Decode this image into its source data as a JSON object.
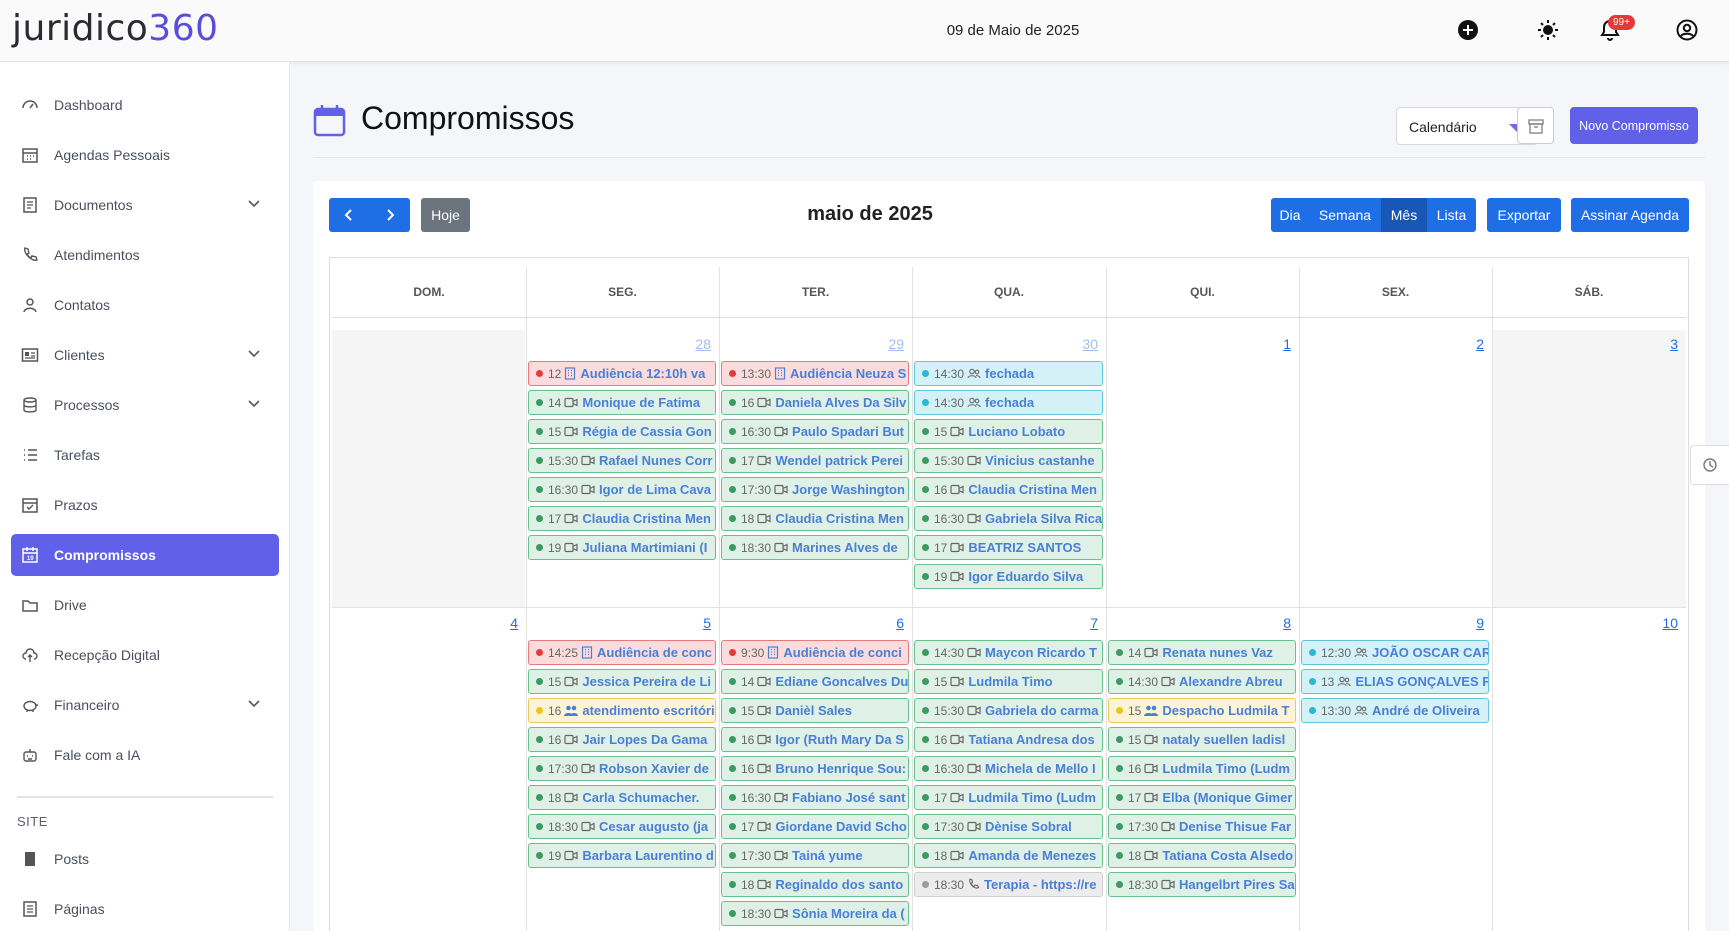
{
  "brand": {
    "part1": "juridico",
    "part2": "360"
  },
  "header": {
    "date": "09 de Maio de 2025",
    "notif_count": "99+",
    "icons": [
      "add-circle-icon",
      "sun-icon",
      "bell-icon",
      "user-circle-icon"
    ]
  },
  "sidebar": {
    "items": [
      {
        "label": "Dashboard",
        "icon": "dashboard-icon"
      },
      {
        "label": "Agendas Pessoais",
        "icon": "calendar-grid-icon"
      },
      {
        "label": "Documentos",
        "icon": "document-icon",
        "expand": true
      },
      {
        "label": "Atendimentos",
        "icon": "phone-icon"
      },
      {
        "label": "Contatos",
        "icon": "person-icon"
      },
      {
        "label": "Clientes",
        "icon": "id-card-icon",
        "expand": true
      },
      {
        "label": "Processos",
        "icon": "database-icon",
        "expand": true
      },
      {
        "label": "Tarefas",
        "icon": "list-icon"
      },
      {
        "label": "Prazos",
        "icon": "checkbox-calendar-icon"
      },
      {
        "label": "Compromissos",
        "icon": "calendar-icon",
        "active": true
      },
      {
        "label": "Drive",
        "icon": "folder-icon"
      },
      {
        "label": "Recepção Digital",
        "icon": "cloud-upload-icon"
      },
      {
        "label": "Financeiro",
        "icon": "piggy-bank-icon",
        "expand": true
      },
      {
        "label": "Fale com a IA",
        "icon": "robot-icon"
      }
    ],
    "section_title": "SITE",
    "site_items": [
      {
        "label": "Posts",
        "icon": "post-icon"
      },
      {
        "label": "Páginas",
        "icon": "page-icon"
      }
    ]
  },
  "page": {
    "title": "Compromissos",
    "view_select": "Calendário",
    "new_button": "Novo Compromisso"
  },
  "calendar": {
    "today_button": "Hoje",
    "month_title": "maio de 2025",
    "views": [
      "Dia",
      "Semana",
      "Mês",
      "Lista"
    ],
    "active_view": "Mês",
    "export_button": "Exportar",
    "subscribe_button": "Assinar Agenda",
    "weekdays": [
      "DOM.",
      "SEG.",
      "TER.",
      "QUA.",
      "QUI.",
      "SEX.",
      "SÁB."
    ],
    "weeks": [
      [
        {
          "day": "",
          "current": false,
          "events": []
        },
        {
          "day": "28",
          "current": false,
          "events": [
            {
              "time": "12",
              "icon": "building",
              "text": "Audiência 12:10h va",
              "color": "r"
            },
            {
              "time": "14",
              "icon": "video",
              "text": "Monique de Fatima",
              "color": "g"
            },
            {
              "time": "15",
              "icon": "video",
              "text": "Régia de Cassia Gon",
              "color": "g"
            },
            {
              "time": "15:30",
              "icon": "video",
              "text": "Rafael Nunes Corr",
              "color": "g"
            },
            {
              "time": "16:30",
              "icon": "video",
              "text": "Igor de Lima Cava",
              "color": "g"
            },
            {
              "time": "17",
              "icon": "video",
              "text": "Claudia Cristina Men",
              "color": "g"
            },
            {
              "time": "19",
              "icon": "video",
              "text": "Juliana Martimiani (I",
              "color": "g"
            }
          ]
        },
        {
          "day": "29",
          "current": false,
          "events": [
            {
              "time": "13:30",
              "icon": "building",
              "text": "Audiência Neuza S",
              "color": "r"
            },
            {
              "time": "16",
              "icon": "video",
              "text": "Daniela Alves Da Silv",
              "color": "g"
            },
            {
              "time": "16:30",
              "icon": "video",
              "text": "Paulo Spadari But",
              "color": "g"
            },
            {
              "time": "17",
              "icon": "video",
              "text": "Wendel patrick Perei",
              "color": "g"
            },
            {
              "time": "17:30",
              "icon": "video",
              "text": "Jorge Washington",
              "color": "g"
            },
            {
              "time": "18",
              "icon": "video",
              "text": "Claudia Cristina Men",
              "color": "g"
            },
            {
              "time": "18:30",
              "icon": "video",
              "text": "Marines Alves de",
              "color": "g"
            }
          ]
        },
        {
          "day": "30",
          "current": false,
          "events": [
            {
              "time": "14:30",
              "icon": "people",
              "text": "fechada",
              "color": "c"
            },
            {
              "time": "14:30",
              "icon": "people",
              "text": "fechada",
              "color": "c"
            },
            {
              "time": "15",
              "icon": "video",
              "text": "Luciano Lobato",
              "color": "g"
            },
            {
              "time": "15:30",
              "icon": "video",
              "text": "Vinicius castanhe",
              "color": "g"
            },
            {
              "time": "16",
              "icon": "video",
              "text": "Claudia Cristina Men",
              "color": "g"
            },
            {
              "time": "16:30",
              "icon": "video",
              "text": "Gabriela Silva Rica",
              "color": "g"
            },
            {
              "time": "17",
              "icon": "video",
              "text": "BEATRIZ SANTOS",
              "color": "g"
            },
            {
              "time": "19",
              "icon": "video",
              "text": "Igor Eduardo Silva",
              "color": "g"
            }
          ]
        },
        {
          "day": "1",
          "current": true,
          "events": []
        },
        {
          "day": "2",
          "current": true,
          "events": []
        },
        {
          "day": "3",
          "current": true,
          "events": []
        }
      ],
      [
        {
          "day": "4",
          "current": true,
          "events": []
        },
        {
          "day": "5",
          "current": true,
          "events": [
            {
              "time": "14:25",
              "icon": "building",
              "text": "Audiência de conc",
              "color": "r"
            },
            {
              "time": "15",
              "icon": "video",
              "text": "Jessica Pereira de Li",
              "color": "g"
            },
            {
              "time": "16",
              "icon": "group",
              "text": "atendimento escritório",
              "color": "y"
            },
            {
              "time": "16",
              "icon": "video",
              "text": "Jair Lopes Da Gama",
              "color": "g"
            },
            {
              "time": "17:30",
              "icon": "video",
              "text": "Robson Xavier de",
              "color": "g"
            },
            {
              "time": "18",
              "icon": "video",
              "text": "Carla Schumacher.",
              "color": "g"
            },
            {
              "time": "18:30",
              "icon": "video",
              "text": "Cesar augusto (ja",
              "color": "g"
            },
            {
              "time": "19",
              "icon": "video",
              "text": "Barbara Laurentino d",
              "color": "g"
            }
          ]
        },
        {
          "day": "6",
          "current": true,
          "events": [
            {
              "time": "9:30",
              "icon": "building",
              "text": "Audiência de conci",
              "color": "r"
            },
            {
              "time": "14",
              "icon": "video",
              "text": "Ediane Goncalves Du",
              "color": "g"
            },
            {
              "time": "15",
              "icon": "video",
              "text": "Danièl Sales",
              "color": "g"
            },
            {
              "time": "16",
              "icon": "video",
              "text": "Igor (Ruth Mary Da S",
              "color": "g"
            },
            {
              "time": "16",
              "icon": "video",
              "text": "Bruno Henrique Sou:",
              "color": "g"
            },
            {
              "time": "16:30",
              "icon": "video",
              "text": "Fabiano José sant",
              "color": "g"
            },
            {
              "time": "17",
              "icon": "video",
              "text": "Giordane David Scho",
              "color": "g"
            },
            {
              "time": "17:30",
              "icon": "video",
              "text": "Tainá yume",
              "color": "g"
            },
            {
              "time": "18",
              "icon": "video",
              "text": "Reginaldo dos santo",
              "color": "g"
            },
            {
              "time": "18:30",
              "icon": "video",
              "text": "Sônia Moreira da (",
              "color": "g"
            }
          ]
        },
        {
          "day": "7",
          "current": true,
          "events": [
            {
              "time": "14:30",
              "icon": "video",
              "text": "Maycon Ricardo T",
              "color": "g"
            },
            {
              "time": "15",
              "icon": "video",
              "text": "Ludmila Timo",
              "color": "g"
            },
            {
              "time": "15:30",
              "icon": "video",
              "text": "Gabriela do carma",
              "color": "g"
            },
            {
              "time": "16",
              "icon": "video",
              "text": "Tatiana Andresa dos",
              "color": "g"
            },
            {
              "time": "16:30",
              "icon": "video",
              "text": "Michela de Mello I",
              "color": "g"
            },
            {
              "time": "17",
              "icon": "video",
              "text": "Ludmila Timo (Ludm",
              "color": "g"
            },
            {
              "time": "17:30",
              "icon": "video",
              "text": "Dènise Sobral",
              "color": "g"
            },
            {
              "time": "18",
              "icon": "video",
              "text": "Amanda de Menezes",
              "color": "g"
            },
            {
              "time": "18:30",
              "icon": "phone",
              "text": "Terapia - https://re",
              "color": "s"
            }
          ]
        },
        {
          "day": "8",
          "current": true,
          "events": [
            {
              "time": "14",
              "icon": "video",
              "text": "Renata nunes Vaz",
              "color": "g"
            },
            {
              "time": "14:30",
              "icon": "video",
              "text": "Alexandre Abreu",
              "color": "g"
            },
            {
              "time": "15",
              "icon": "group",
              "text": "Despacho Ludmila T",
              "color": "y"
            },
            {
              "time": "15",
              "icon": "video",
              "text": "nataly suellen ladisl",
              "color": "g"
            },
            {
              "time": "16",
              "icon": "video",
              "text": "Ludmila Timo (Ludm",
              "color": "g"
            },
            {
              "time": "17",
              "icon": "video",
              "text": "Elba (Monique Gimer",
              "color": "g"
            },
            {
              "time": "17:30",
              "icon": "video",
              "text": "Denise Thisue Far",
              "color": "g"
            },
            {
              "time": "18",
              "icon": "video",
              "text": "Tatiana Costa Alsedo",
              "color": "g"
            },
            {
              "time": "18:30",
              "icon": "video",
              "text": "Hangelbrt Pires Sa",
              "color": "g"
            }
          ]
        },
        {
          "day": "9",
          "current": true,
          "events": [
            {
              "time": "12:30",
              "icon": "people",
              "text": "JOÃO OSCAR CAR",
              "color": "c"
            },
            {
              "time": "13",
              "icon": "people",
              "text": "ELIAS GONÇALVES F",
              "color": "c"
            },
            {
              "time": "13:30",
              "icon": "people",
              "text": "André de Oliveira",
              "color": "c"
            }
          ]
        },
        {
          "day": "10",
          "current": true,
          "events": []
        }
      ]
    ]
  }
}
